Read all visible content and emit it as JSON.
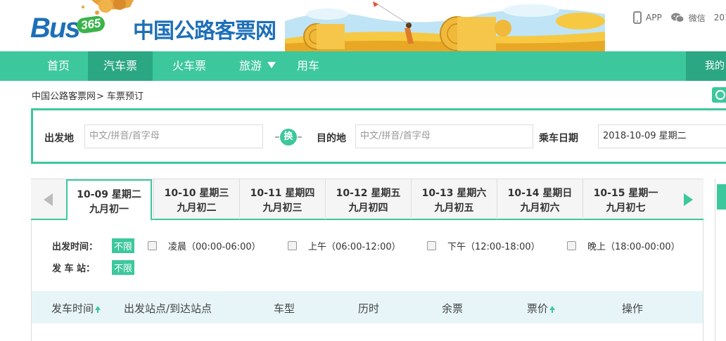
{
  "header": {
    "logo_text": "Bus",
    "logo_number": "365",
    "site_name": "中国公路客票网",
    "app_label": "APP",
    "wechat_label": "微信",
    "year_fragment": "201"
  },
  "nav": {
    "items": [
      {
        "label": "首页"
      },
      {
        "label": "汽车票"
      },
      {
        "label": "火车票"
      },
      {
        "label": "旅游"
      },
      {
        "label": "用车"
      }
    ],
    "active": "汽车票",
    "right_label": "我的"
  },
  "breadcrumb": {
    "home": "中国公路客票网",
    "separator": ">",
    "current": "车票预订"
  },
  "search": {
    "from_label": "出发地",
    "from_placeholder": "中文/拼音/首字母",
    "swap_label": "换",
    "to_label": "目的地",
    "to_placeholder": "中文/拼音/首字母",
    "date_label": "乘车日期",
    "date_value": "2018-10-09 星期二"
  },
  "date_tabs": [
    {
      "date": "10-09 星期二",
      "lunar": "九月初一"
    },
    {
      "date": "10-10 星期三",
      "lunar": "九月初二"
    },
    {
      "date": "10-11 星期四",
      "lunar": "九月初三"
    },
    {
      "date": "10-12 星期五",
      "lunar": "九月初四"
    },
    {
      "date": "10-13 星期六",
      "lunar": "九月初五"
    },
    {
      "date": "10-14 星期日",
      "lunar": "九月初六"
    },
    {
      "date": "10-15 星期一",
      "lunar": "九月初七"
    }
  ],
  "filters": {
    "time_label": "出发时间：",
    "station_label": "发 车 站：",
    "unlimited": "不限",
    "time_options": [
      "凌晨（00:00-06:00）",
      "上午（06:00-12:00）",
      "下午（12:00-18:00）",
      "晚上（18:00-00:00）"
    ]
  },
  "table_header": {
    "depart_time": "发车时间",
    "stations": "出发站点/到达站点",
    "bus_type": "车型",
    "duration": "历时",
    "remaining": "余票",
    "price": "票价",
    "action": "操作"
  },
  "colors": {
    "accent": "#3dc79d",
    "accent_dark": "#2ba783",
    "brand_blue": "#1d6fb8",
    "table_header_bg": "#e7f5f9"
  }
}
